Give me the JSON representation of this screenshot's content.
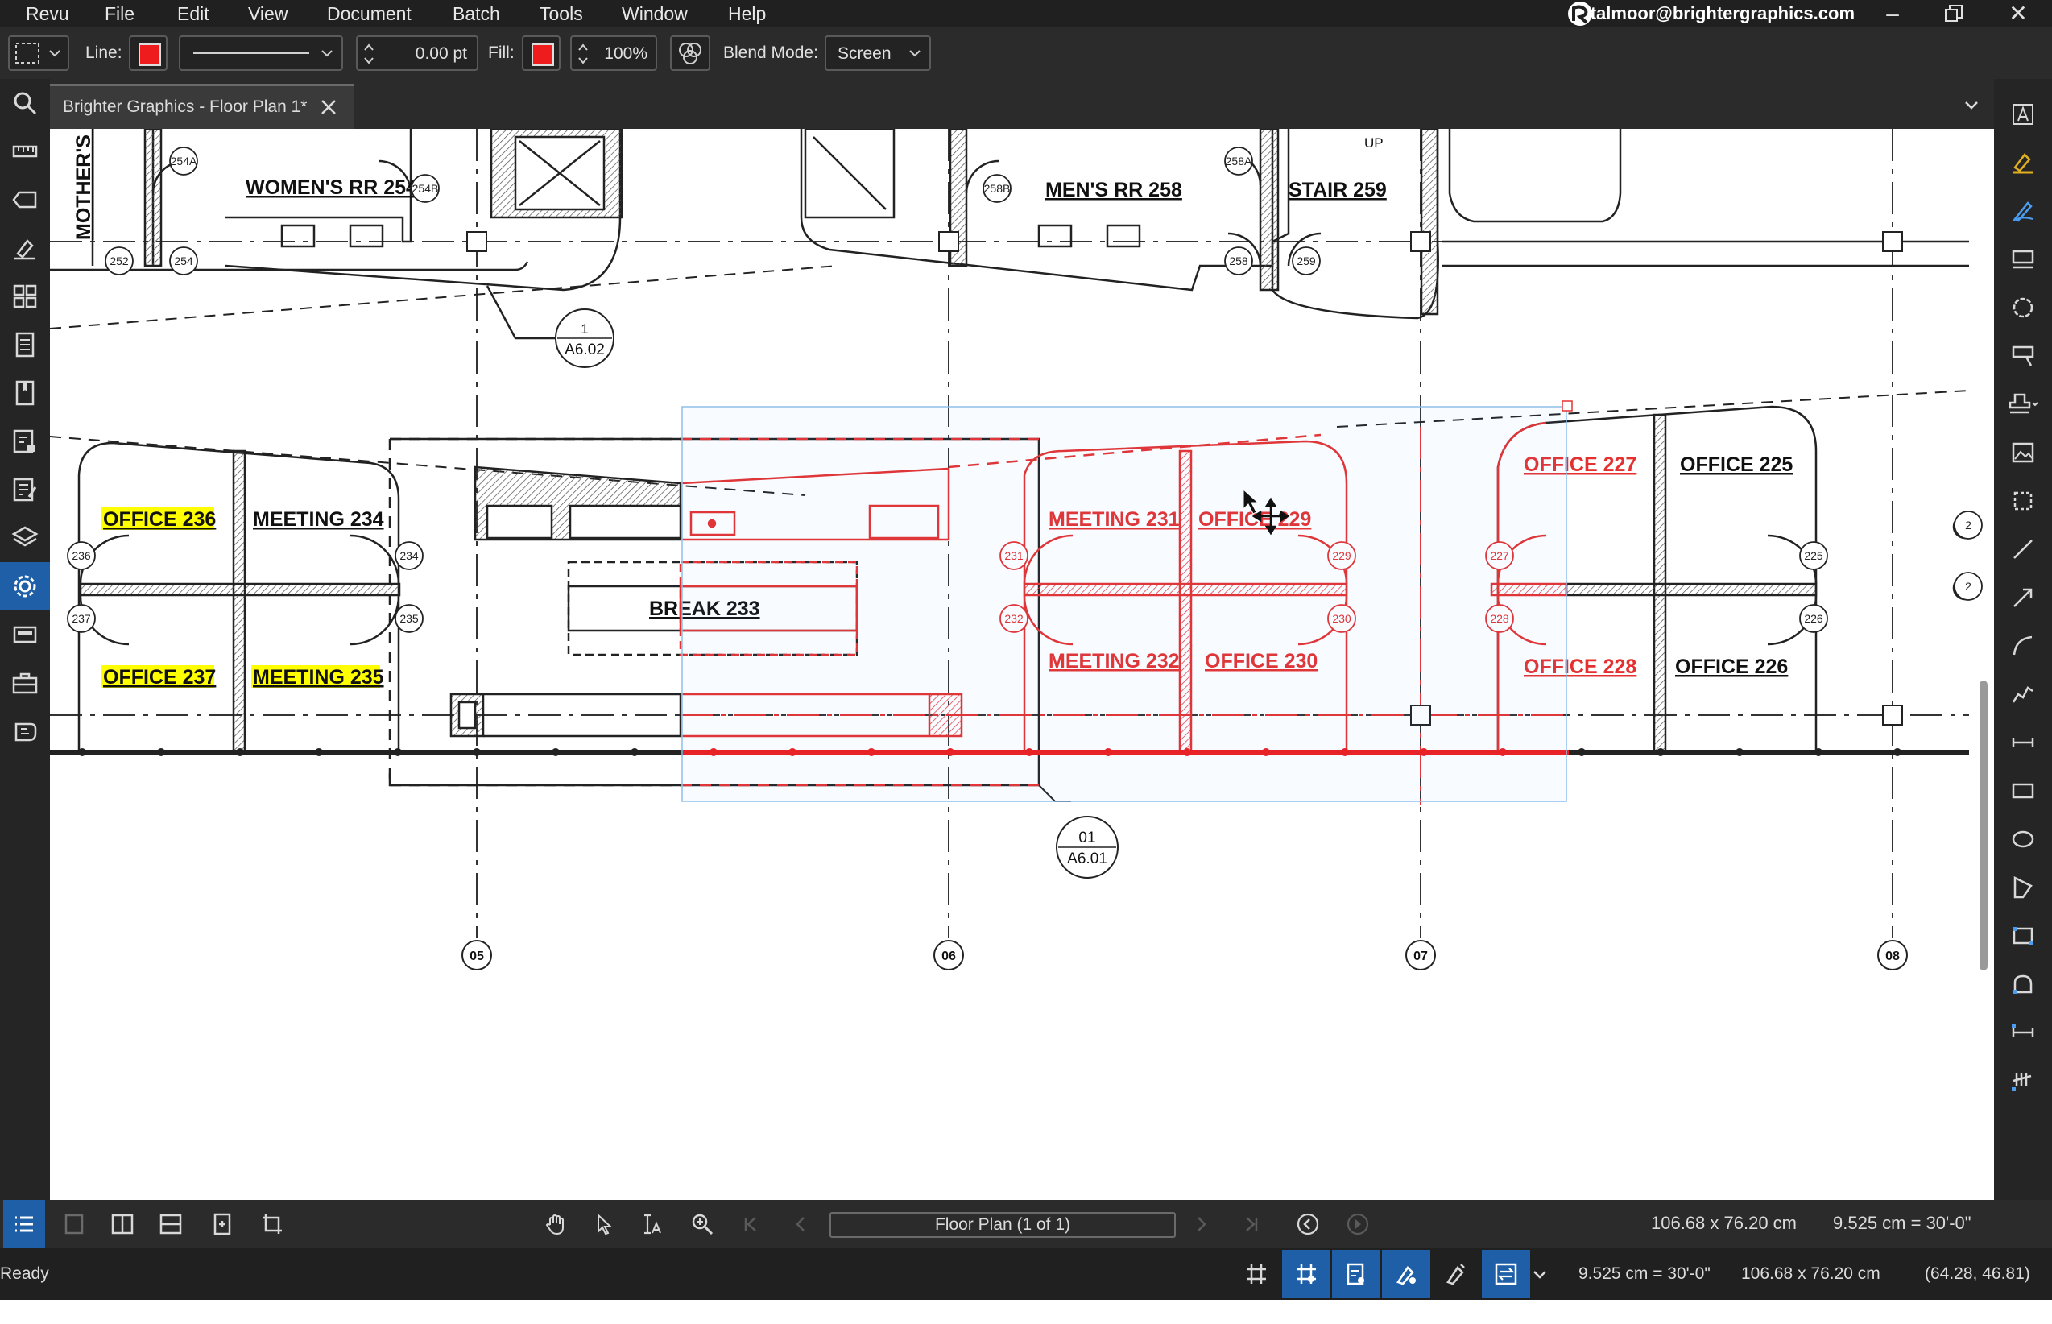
{
  "menu": {
    "items": [
      "Revu",
      "File",
      "Edit",
      "View",
      "Document",
      "Batch",
      "Tools",
      "Window",
      "Help"
    ],
    "user_email": "talmoor@brightergraphics.com"
  },
  "properties_toolbar": {
    "line_label": "Line:",
    "line_color": "#ee1c1c",
    "line_width": "0.00 pt",
    "fill_label": "Fill:",
    "fill_color": "#ee1c1c",
    "opacity": "100%",
    "blend_mode_label": "Blend Mode:",
    "blend_mode_value": "Screen"
  },
  "tab": {
    "title": "Brighter Graphics - Floor Plan 1*"
  },
  "drawing": {
    "markup_color": "#ee1c1c",
    "highlight_color": "#ffff00",
    "rooms_top": [
      {
        "id": "mothers",
        "label": "MOTHER'S R"
      },
      {
        "id": "womens",
        "label": "WOMEN'S RR 254"
      },
      {
        "id": "mens",
        "label": "MEN'S RR 258"
      },
      {
        "id": "stair",
        "label": "STAIR 259"
      }
    ],
    "rooms_left": [
      {
        "id": "o236",
        "label": "OFFICE 236",
        "highlight": true
      },
      {
        "id": "m234",
        "label": "MEETING 234",
        "highlight": false
      },
      {
        "id": "o237",
        "label": "OFFICE 237",
        "highlight": true
      },
      {
        "id": "m235",
        "label": "MEETING 235",
        "highlight": true
      }
    ],
    "break_room": "BREAK 233",
    "rooms_red": [
      {
        "id": "m231",
        "label": "MEETING 231"
      },
      {
        "id": "o229",
        "label": "OFFICE 229"
      },
      {
        "id": "m232",
        "label": "MEETING 232"
      },
      {
        "id": "o230",
        "label": "OFFICE 230"
      },
      {
        "id": "o227",
        "label": "OFFICE 227"
      },
      {
        "id": "o228",
        "label": "OFFICE 228"
      }
    ],
    "rooms_right": [
      {
        "id": "o225",
        "label": "OFFICE 225"
      },
      {
        "id": "o226",
        "label": "OFFICE 226"
      }
    ],
    "door_tags": {
      "t254A": "254A",
      "t254B": "254B",
      "t252": "252",
      "t254": "254",
      "t258B": "258B",
      "t258A": "258A",
      "t258": "258",
      "t259": "259",
      "t236": "236",
      "t237": "237",
      "t234": "234",
      "t235": "235",
      "t231": "231",
      "t232": "232",
      "t229": "229",
      "t230": "230",
      "t227": "227",
      "t228": "228",
      "t225": "225",
      "t226": "226",
      "tp1": "2",
      "tp2": "2"
    },
    "stair_up": "UP",
    "callout_top": {
      "num": "1",
      "sheet": "A6.02"
    },
    "callout_bottom": {
      "num": "01",
      "sheet": "A6.01"
    },
    "grid_bubbles": [
      "05",
      "06",
      "07",
      "08"
    ]
  },
  "navigation": {
    "page_label": "Floor Plan (1 of 1)",
    "page_size": "106.68 x 76.20 cm",
    "scale": "9.525 cm = 30'-0\""
  },
  "status": {
    "ready": "Ready",
    "scale": "9.525 cm = 30'-0\"",
    "page_size": "106.68 x 76.20 cm",
    "cursor": "(64.28, 46.81)"
  }
}
